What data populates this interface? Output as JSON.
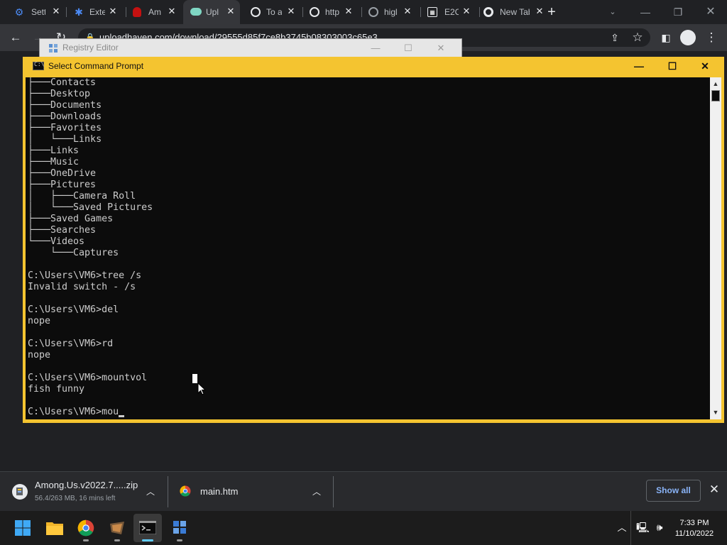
{
  "browser": {
    "tabs": [
      {
        "label": "Setti",
        "icon": "settings-icon",
        "color": "#4c8bf5"
      },
      {
        "label": "Exte",
        "icon": "puzzle-icon",
        "color": "#4c8bf5"
      },
      {
        "label": "Am",
        "icon": "among-us-icon",
        "color": "#c51111"
      },
      {
        "label": "Upl",
        "icon": "cloud-icon",
        "color": "#7fd6c3"
      },
      {
        "label": "To a",
        "icon": "globe-icon",
        "color": "#e8eaed"
      },
      {
        "label": "http",
        "icon": "globe-icon",
        "color": "#e8eaed"
      },
      {
        "label": "higl",
        "icon": "globe-icon",
        "color": "#9aa0a6"
      },
      {
        "label": "E2C",
        "icon": "grid-icon",
        "color": "#e8eaed"
      },
      {
        "label": "New Tab",
        "icon": "chrome-icon",
        "color": "#e8eaed"
      }
    ],
    "url": "uploadhaven.com/download/29555d85f7ce8b3745b08303003c65e3"
  },
  "regedit": {
    "title": "Registry Editor"
  },
  "cmd": {
    "title": "Select Command Prompt",
    "lines": [
      "├───Contacts",
      "├───Desktop",
      "├───Documents",
      "├───Downloads",
      "├───Favorites",
      "│   └───Links",
      "├───Links",
      "├───Music",
      "├───OneDrive",
      "├───Pictures",
      "│   ├───Camera Roll",
      "│   └───Saved Pictures",
      "├───Saved Games",
      "├───Searches",
      "└───Videos",
      "    └───Captures",
      "",
      "C:\\Users\\VM6>tree /s",
      "Invalid switch - /s",
      "",
      "C:\\Users\\VM6>del",
      "nope",
      "",
      "C:\\Users\\VM6>rd",
      "nope",
      "",
      "C:\\Users\\VM6>mountvol",
      "fish funny",
      "",
      "C:\\Users\\VM6>mou"
    ]
  },
  "downloads": [
    {
      "name": "Among.Us.v2022.7.....zip",
      "status": "56.4/263 MB, 16 mins left",
      "icon": "zip-file-icon"
    },
    {
      "name": "main.htm",
      "status": "",
      "icon": "chrome-icon"
    }
  ],
  "downloads_show_all": "Show all",
  "taskbar": {
    "apps": [
      "start-icon",
      "file-explorer-icon",
      "chrome-icon",
      "game-icon",
      "command-prompt-icon",
      "registry-editor-icon"
    ],
    "time": "7:33 PM",
    "date": "11/10/2022"
  }
}
